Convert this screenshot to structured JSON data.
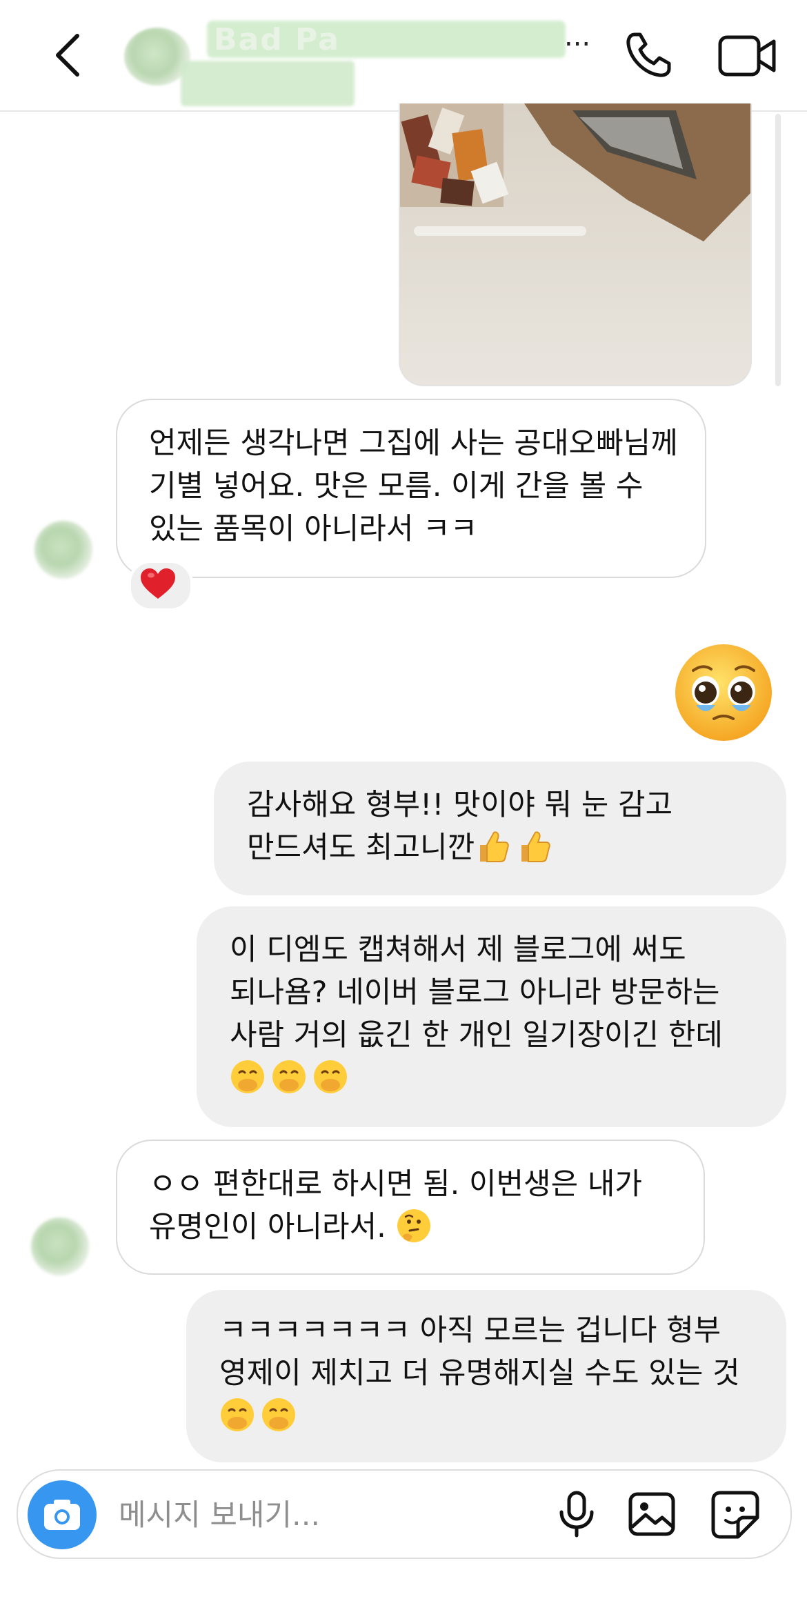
{
  "header": {
    "contact_name_visible": "Bad  Pa",
    "ellipsis": "...",
    "back_icon": "chevron-left-icon",
    "call_icon": "phone-icon",
    "video_icon": "video-camera-icon"
  },
  "messages": [
    {
      "side": "incoming",
      "text": "언제든 생각나면 그집에 사는 공대오빠님께 기별 넣어요. 맛은 모름. 이게 간을 볼 수 있는 품목이 아니라서 ㅋㅋ",
      "reaction": "❤️"
    },
    {
      "side": "outgoing",
      "emoji_only": "🥹"
    },
    {
      "side": "outgoing",
      "text": "감사해요 형부!! 맛이야 뭐 눈 감고 만드셔도 최고니깐",
      "emojis": [
        "👍",
        "👍"
      ]
    },
    {
      "side": "outgoing",
      "text": "이 디엠도 캡쳐해서 제 블로그에 써도 되나욤? 네이버 블로그 아니라 방문하는 사람 거의 읎긴 한 개인 일기장이긴 한데",
      "emojis": [
        "🤭",
        "🤭",
        "🤭"
      ]
    },
    {
      "side": "incoming",
      "text": "ㅇㅇ 편한대로 하시면 됨. 이번생은 내가 유명인이 아니라서.",
      "emojis": [
        "🤔"
      ]
    },
    {
      "side": "outgoing",
      "text": "ㅋㅋㅋㅋㅋㅋㅋ 아직 모르는 겁니다 형부 영제이 제치고 더 유명해지실 수도 있는 것",
      "emojis": [
        "🤭",
        "🤭"
      ]
    }
  ],
  "composer": {
    "placeholder": "메시지 보내기...",
    "camera_icon": "camera-icon",
    "mic_icon": "microphone-icon",
    "gallery_icon": "image-icon",
    "sticker_icon": "sticker-icon"
  },
  "colors": {
    "accent": "#3797f0",
    "bubble_outgoing": "#efefef",
    "bubble_incoming_border": "#dadada",
    "reaction_heart": "#e0202a"
  }
}
